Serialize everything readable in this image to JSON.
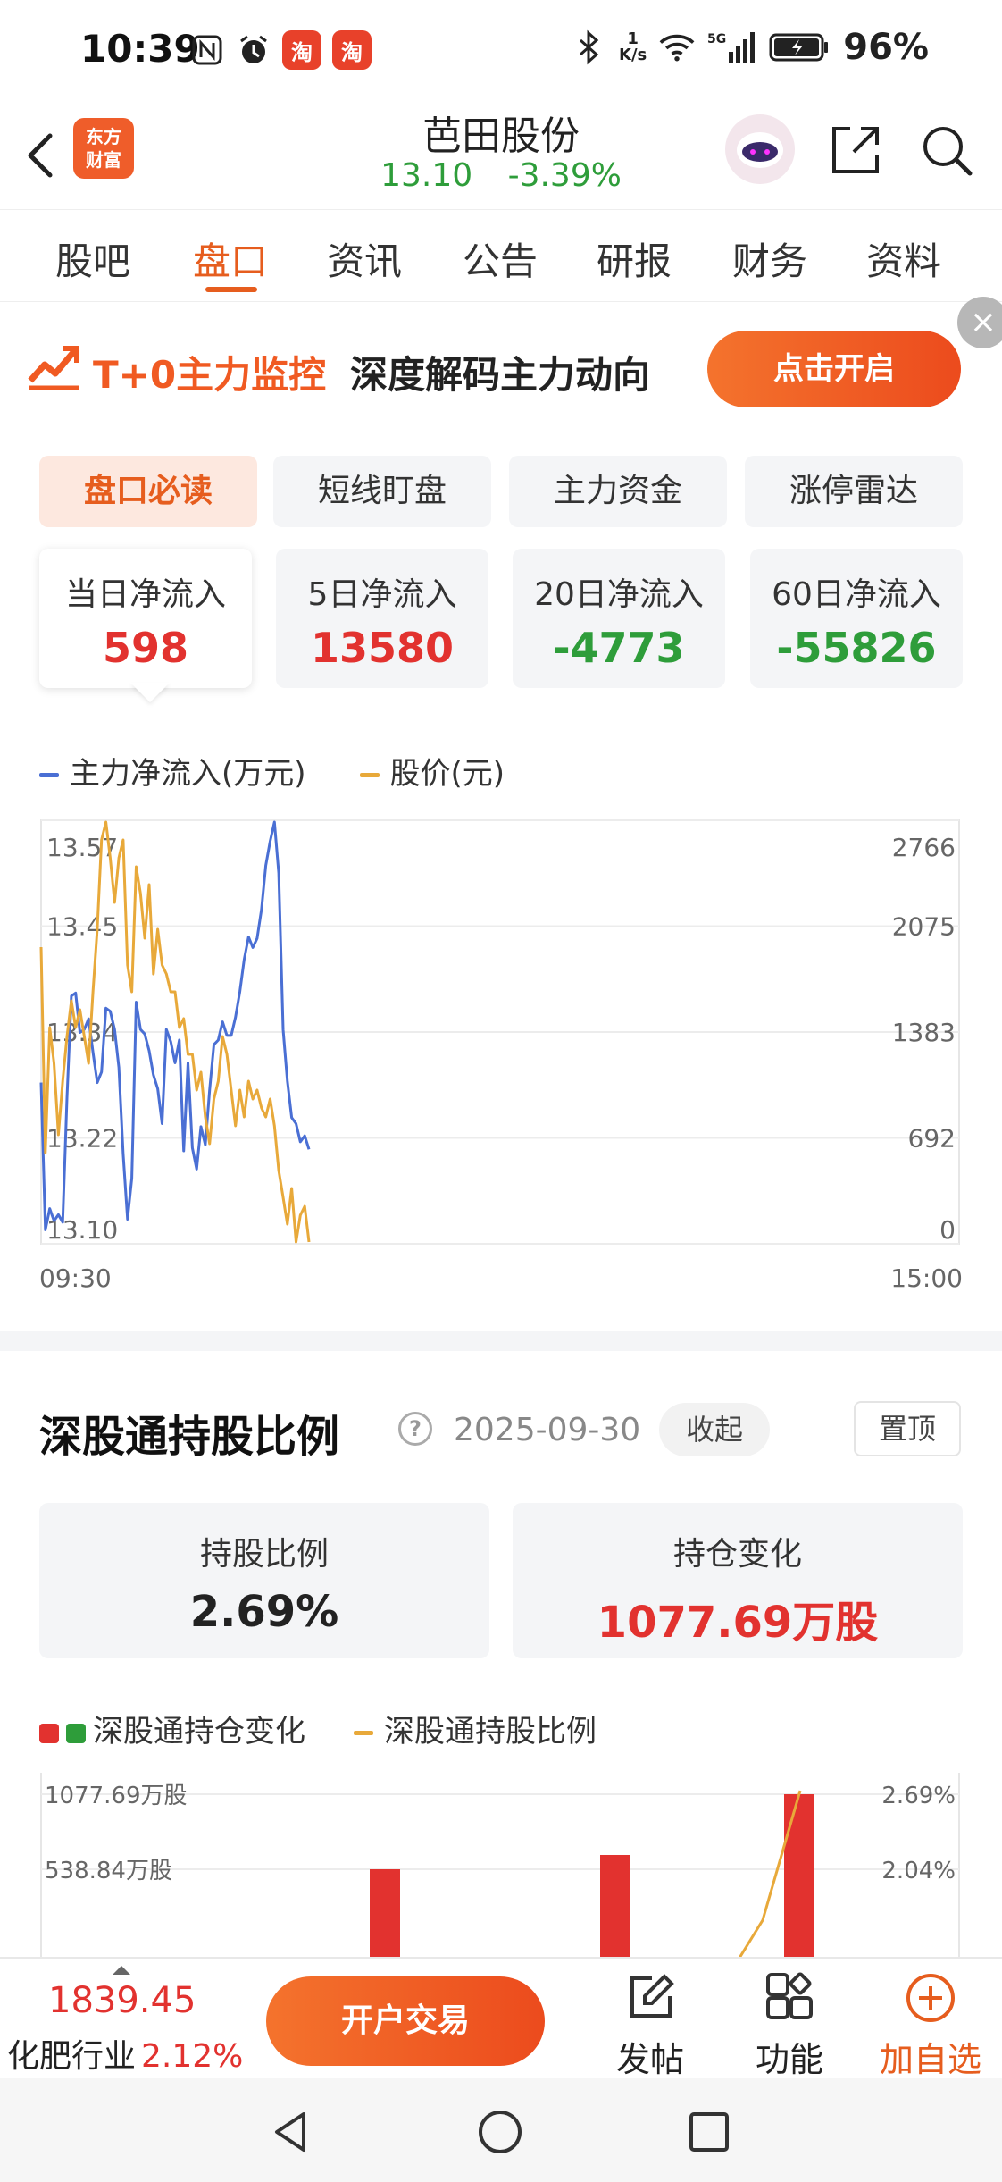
{
  "status": {
    "time": "10:39",
    "net_speed_top": "1",
    "net_speed_bottom": "K/s",
    "network": "5G",
    "battery": "96%"
  },
  "header": {
    "logo_line1": "东方",
    "logo_line2": "财富",
    "stock_name": "芭田股份",
    "price": "13.10",
    "change": "-3.39%"
  },
  "tabs": [
    {
      "label": "股吧"
    },
    {
      "label": "盘口"
    },
    {
      "label": "资讯"
    },
    {
      "label": "公告"
    },
    {
      "label": "研报"
    },
    {
      "label": "财务"
    },
    {
      "label": "资料"
    }
  ],
  "banner": {
    "title": "T+0主力监控",
    "subtitle": "深度解码主力动向",
    "button": "点击开启",
    "close": "×"
  },
  "subtabs": [
    {
      "label": "盘口必读"
    },
    {
      "label": "短线盯盘"
    },
    {
      "label": "主力资金"
    },
    {
      "label": "涨停雷达"
    }
  ],
  "flows": [
    {
      "label": "当日净流入",
      "value": "598"
    },
    {
      "label": "5日净流入",
      "value": "13580"
    },
    {
      "label": "20日净流入",
      "value": "-4773"
    },
    {
      "label": "60日净流入",
      "value": "-55826"
    }
  ],
  "chart_data": [
    {
      "type": "line",
      "series": [
        {
          "name": "主力净流入(万元)",
          "color": "#4a6fd4",
          "axis": "right",
          "values": [
            1050,
            80,
            220,
            140,
            180,
            130,
            950,
            1620,
            1640,
            1380,
            1400,
            1470,
            1250,
            1050,
            1120,
            1540,
            1520,
            1400,
            1150,
            580,
            150,
            420,
            1580,
            1400,
            1370,
            1260,
            1100,
            1010,
            780,
            1400,
            1320,
            1180,
            1330,
            600,
            1180,
            620,
            480,
            760,
            640,
            1000,
            1300,
            1330,
            1450,
            1360,
            1360,
            1480,
            1650,
            1860,
            2010,
            1940,
            2000,
            2190,
            2480,
            2640,
            2766,
            2430,
            1400,
            1060,
            820,
            780,
            660,
            700,
            610
          ]
        },
        {
          "name": "股价(元)",
          "color": "#e8a93a",
          "axis": "left",
          "values": [
            13.43,
            13.2,
            13.34,
            13.3,
            13.22,
            13.28,
            13.33,
            13.37,
            13.34,
            13.36,
            13.33,
            13.3,
            13.38,
            13.45,
            13.55,
            13.57,
            13.53,
            13.48,
            13.53,
            13.55,
            13.41,
            13.38,
            13.52,
            13.49,
            13.44,
            13.5,
            13.4,
            13.45,
            13.41,
            13.4,
            13.38,
            13.38,
            13.34,
            13.35,
            13.31,
            13.31,
            13.27,
            13.29,
            13.24,
            13.21,
            13.26,
            13.28,
            13.33,
            13.31,
            13.27,
            13.23,
            13.27,
            13.24,
            13.28,
            13.26,
            13.27,
            13.25,
            13.24,
            13.26,
            13.23,
            13.18,
            13.15,
            13.12,
            13.16,
            13.1,
            13.13,
            13.14,
            13.1
          ]
        }
      ],
      "x_labels": [
        "09:30",
        "15:00"
      ],
      "y_left_ticks": [
        "13.57",
        "13.45",
        "13.34",
        "13.22",
        "13.10"
      ],
      "y_right_ticks": [
        "2766",
        "2075",
        "1383",
        "692",
        "0"
      ],
      "y_left_range": [
        13.1,
        13.57
      ],
      "y_right_range": [
        0,
        2766
      ]
    },
    {
      "type": "bar",
      "series": [
        {
          "name": "深股通持仓变化",
          "values": [
            538.84,
            641.5,
            1077.69
          ],
          "colors": [
            "#e2322f",
            "#2e9d3a"
          ]
        },
        {
          "name": "深股通持股比例",
          "color": "#e8a93a"
        }
      ],
      "y_left_ticks": [
        "1077.69万股",
        "538.84万股"
      ],
      "y_right_ticks": [
        "2.69%",
        "2.04%"
      ]
    }
  ],
  "legend1": {
    "main_flow": "主力净流入(万元)",
    "price": "股价(元)"
  },
  "hk": {
    "title": "深股通持股比例",
    "date": "2025-09-30",
    "collapse": "收起",
    "pin": "置顶",
    "ratio_label": "持股比例",
    "ratio_value": "2.69%",
    "change_label": "持仓变化",
    "change_value": "1077.69万股",
    "legend_change": "深股通持仓变化",
    "legend_ratio": "深股通持股比例"
  },
  "bottom": {
    "index_value": "1839.45",
    "industry": "化肥行业",
    "industry_change": "2.12%",
    "trade_button": "开户交易",
    "post": "发帖",
    "functions": "功能",
    "add_watch": "加自选"
  }
}
